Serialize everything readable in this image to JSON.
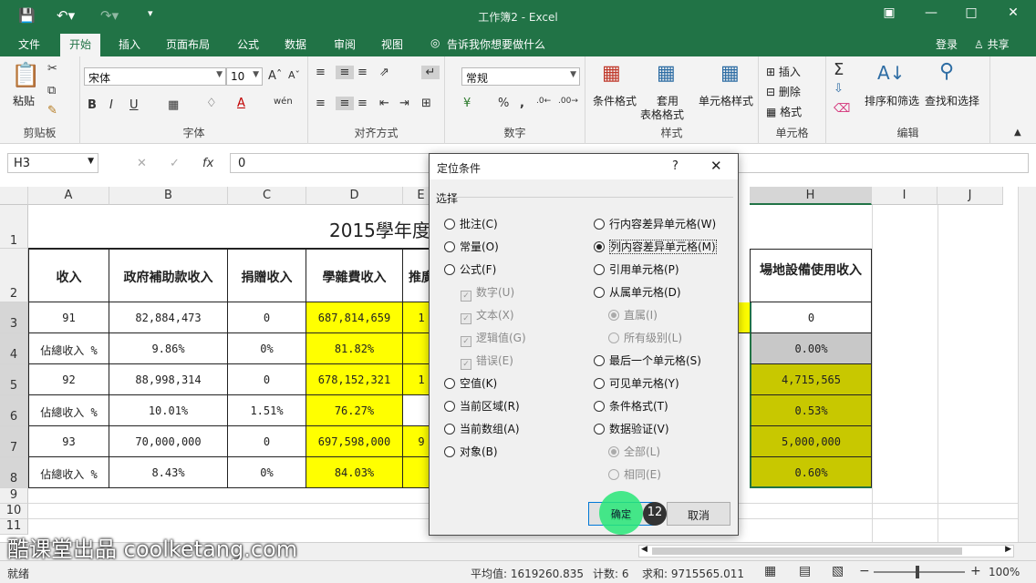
{
  "window": {
    "title": "工作簿2 - Excel",
    "login": "登录",
    "share": "共享"
  },
  "tabs": [
    "文件",
    "开始",
    "插入",
    "页面布局",
    "公式",
    "数据",
    "审阅",
    "视图"
  ],
  "tell_me": "告诉我你想要做什么",
  "ribbon": {
    "clipboard": {
      "label": "剪贴板",
      "paste": "粘贴"
    },
    "font": {
      "label": "字体",
      "name": "宋体",
      "size": "10"
    },
    "align": {
      "label": "对齐方式"
    },
    "number": {
      "label": "数字",
      "format": "常规"
    },
    "styles": {
      "label": "样式",
      "cond": "条件格式",
      "table1": "套用",
      "table2": "表格格式",
      "cell": "单元格样式"
    },
    "cells": {
      "label": "单元格",
      "insert": "插入",
      "delete": "删除",
      "format": "格式"
    },
    "edit": {
      "label": "编辑",
      "sort": "排序和筛选",
      "find": "查找和选择"
    }
  },
  "formula_bar": {
    "name_box": "H3",
    "value": "0"
  },
  "columns": [
    "A",
    "B",
    "C",
    "D",
    "E",
    "H",
    "I",
    "J"
  ],
  "rows": [
    "1",
    "2",
    "3",
    "4",
    "5",
    "6",
    "7",
    "8",
    "9",
    "10",
    "11"
  ],
  "sheet": {
    "title": "2015學年度",
    "headers": {
      "a": "收入",
      "b": "政府補助款收入",
      "c": "捐贈收入",
      "d": "學雜費收入",
      "e": "推廣",
      "h": "場地設備使用收入"
    },
    "data": [
      {
        "a": "91",
        "b": "82,884,473",
        "c": "0",
        "d": "687,814,659",
        "e": "1",
        "h": "0"
      },
      {
        "a": "佔總收入 %",
        "b": "9.86%",
        "c": "0%",
        "d": "81.82%",
        "e": "",
        "h": "0.00%"
      },
      {
        "a": "92",
        "b": "88,998,314",
        "c": "0",
        "d": "678,152,321",
        "e": "1",
        "h": "4,715,565"
      },
      {
        "a": "佔總收入 %",
        "b": "10.01%",
        "c": "1.51%",
        "d": "76.27%",
        "e": "",
        "h": "0.53%"
      },
      {
        "a": "93",
        "b": "70,000,000",
        "c": "0",
        "d": "697,598,000",
        "e": "9",
        "h": "5,000,000"
      },
      {
        "a": "佔總收入 %",
        "b": "8.43%",
        "c": "0%",
        "d": "84.03%",
        "e": "",
        "h": "0.60%"
      }
    ]
  },
  "dialog": {
    "title": "定位条件",
    "help": "?",
    "section": "选择",
    "left": [
      "批注(C)",
      "常量(O)",
      "公式(F)",
      "数字(U)",
      "文本(X)",
      "逻辑值(G)",
      "错误(E)",
      "空值(K)",
      "当前区域(R)",
      "当前数组(A)",
      "对象(B)"
    ],
    "right": [
      "行内容差异单元格(W)",
      "列内容差异单元格(M)",
      "引用单元格(P)",
      "从属单元格(D)",
      "直属(I)",
      "所有级别(L)",
      "最后一个单元格(S)",
      "可见单元格(Y)",
      "条件格式(T)",
      "数据验证(V)",
      "全部(L)",
      "相同(E)"
    ],
    "ok": "确定",
    "cancel": "取消",
    "step": "12"
  },
  "status": {
    "ready": "就绪",
    "avg": "平均值: 1619260.835",
    "count": "计数: 6",
    "sum": "求和: 9715565.011",
    "zoom": "100%"
  },
  "watermark": "酷课堂出品 coolketang.com"
}
